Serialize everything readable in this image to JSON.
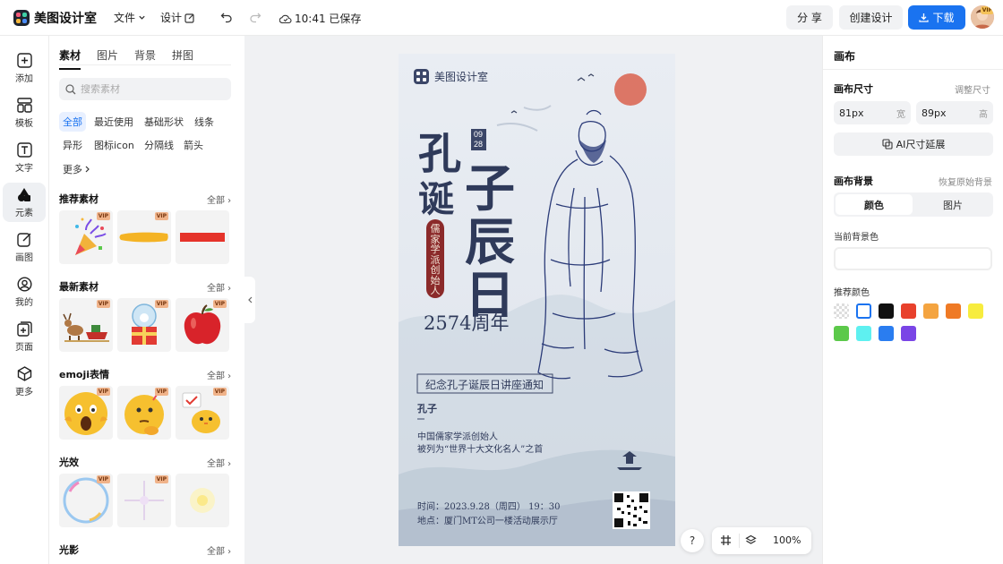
{
  "app": {
    "name": "美图设计室"
  },
  "topbar": {
    "file_menu": "文件",
    "design_menu": "设计",
    "save_status": "10:41 已保存",
    "share_label": "分 享",
    "create_label": "创建设计",
    "download_label": "下载",
    "avatar_badge": "VIP"
  },
  "left_rail": [
    {
      "label": "添加",
      "icon": "plus-square-icon"
    },
    {
      "label": "模板",
      "icon": "template-icon"
    },
    {
      "label": "文字",
      "icon": "text-icon"
    },
    {
      "label": "元素",
      "icon": "shapes-icon",
      "active": true
    },
    {
      "label": "画图",
      "icon": "pencil-icon"
    },
    {
      "label": "我的",
      "icon": "user-icon"
    },
    {
      "label": "页面",
      "icon": "add-page-icon"
    },
    {
      "label": "更多",
      "icon": "cube-icon"
    }
  ],
  "panel": {
    "tabs": [
      "素材",
      "图片",
      "背景",
      "拼图"
    ],
    "active_tab": "素材",
    "search_placeholder": "搜索素材",
    "chips": [
      "全部",
      "最近使用",
      "基础形状",
      "线条",
      "异形",
      "图标icon",
      "分隔线",
      "箭头",
      "更多"
    ],
    "active_chip": "全部",
    "all_label": "全部",
    "vip_badge": "VIP",
    "sections": [
      {
        "title": "推荐素材",
        "items": [
          "party-popper",
          "yellow-brush-stroke",
          "red-bar"
        ]
      },
      {
        "title": "最新素材",
        "items": [
          "reindeer-sleigh",
          "snow-globe-gift",
          "red-apple"
        ]
      },
      {
        "title": "emoji表情",
        "items": [
          "shocked-emoji",
          "thinking-emoji",
          "chick-emoji"
        ]
      },
      {
        "title": "光效",
        "items": [
          "bubble-ring",
          "star-sparkle",
          "soft-glow"
        ]
      },
      {
        "title": "光影",
        "items": []
      }
    ]
  },
  "poster": {
    "brand": "美图设计室",
    "title_chars": [
      "孔",
      "诞",
      "子",
      "辰",
      "日"
    ],
    "date_tag": [
      "09",
      "28"
    ],
    "seal_text": "儒家学派创始人",
    "anniversary": "2574周年",
    "notice_title": "纪念孔子诞辰日讲座通知",
    "person_name": "孔子",
    "person_desc_1": "中国儒家学派创始人",
    "person_desc_2": "被列为“世界十大文化名人”之首",
    "time_line": "时间：2023.9.28（周四） 19：30",
    "place_line": "地点：厦门MT公司一楼活动展示厅"
  },
  "right_panel": {
    "title": "画布",
    "size_label": "画布尺寸",
    "adjust_size": "调整尺寸",
    "width_value": "81px",
    "width_unit": "宽",
    "height_value": "89px",
    "height_unit": "高",
    "ai_extend": "AI尺寸延展",
    "bg_label": "画布背景",
    "restore_bg": "恢复原始背景",
    "bg_tabs": [
      "颜色",
      "图片"
    ],
    "current_bg_label": "当前背景色",
    "recommended_label": "推荐颜色",
    "swatches": [
      "transparent",
      "#ffffff",
      "#111111",
      "#e8412c",
      "#f4a440",
      "#ef7a25",
      "#f7ec3e",
      "#5cc94a",
      "#5ef0f0",
      "#2a7df0",
      "#7a45e6"
    ]
  },
  "bottom": {
    "help": "?",
    "zoom": "100%"
  },
  "colors": {
    "accent": "#1a73f0",
    "poster_ink": "#2f3a5a",
    "poster_red": "#8b2a2a"
  }
}
